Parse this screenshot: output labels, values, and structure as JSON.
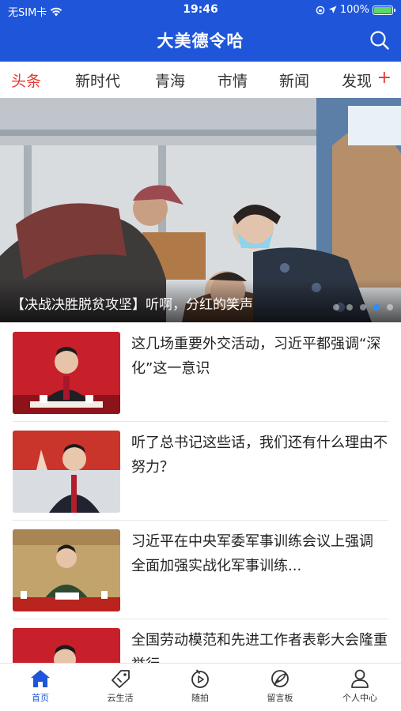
{
  "status_bar": {
    "carrier": "无SIM卡",
    "time": "19:46",
    "battery": "100%",
    "battery_level": 1.0
  },
  "header": {
    "title": "大美德令哈",
    "search_icon": "search-icon"
  },
  "tabs": [
    {
      "label": "头条",
      "active": true
    },
    {
      "label": "新时代",
      "active": false
    },
    {
      "label": "青海",
      "active": false
    },
    {
      "label": "市情",
      "active": false
    },
    {
      "label": "新闻",
      "active": false
    },
    {
      "label": "发现",
      "active": false
    }
  ],
  "tab_add_label": "+",
  "hero": {
    "caption": "【决战决胜脱贫攻坚】听啊，分红的笑声",
    "slide_count": 5,
    "active_slide": 3
  },
  "news": [
    {
      "title": "这几场重要外交活动，习近平都强调“深化”这一意识"
    },
    {
      "title": "听了总书记这些话，我们还有什么理由不努力？"
    },
    {
      "title": "习近平在中央军委军事训练会议上强调 全面加强实战化军事训练..."
    },
    {
      "title": "全国劳动模范和先进工作者表彰大会隆重举行"
    }
  ],
  "bottom_nav": [
    {
      "label": "首页",
      "icon": "home-icon",
      "active": true
    },
    {
      "label": "云生活",
      "icon": "tag-icon",
      "active": false
    },
    {
      "label": "随拍",
      "icon": "camera-play-icon",
      "active": false
    },
    {
      "label": "留言板",
      "icon": "feather-pen-icon",
      "active": false
    },
    {
      "label": "个人中心",
      "icon": "person-icon",
      "active": false
    }
  ],
  "colors": {
    "brand_blue": "#1f56d9",
    "accent_red": "#e53935"
  }
}
